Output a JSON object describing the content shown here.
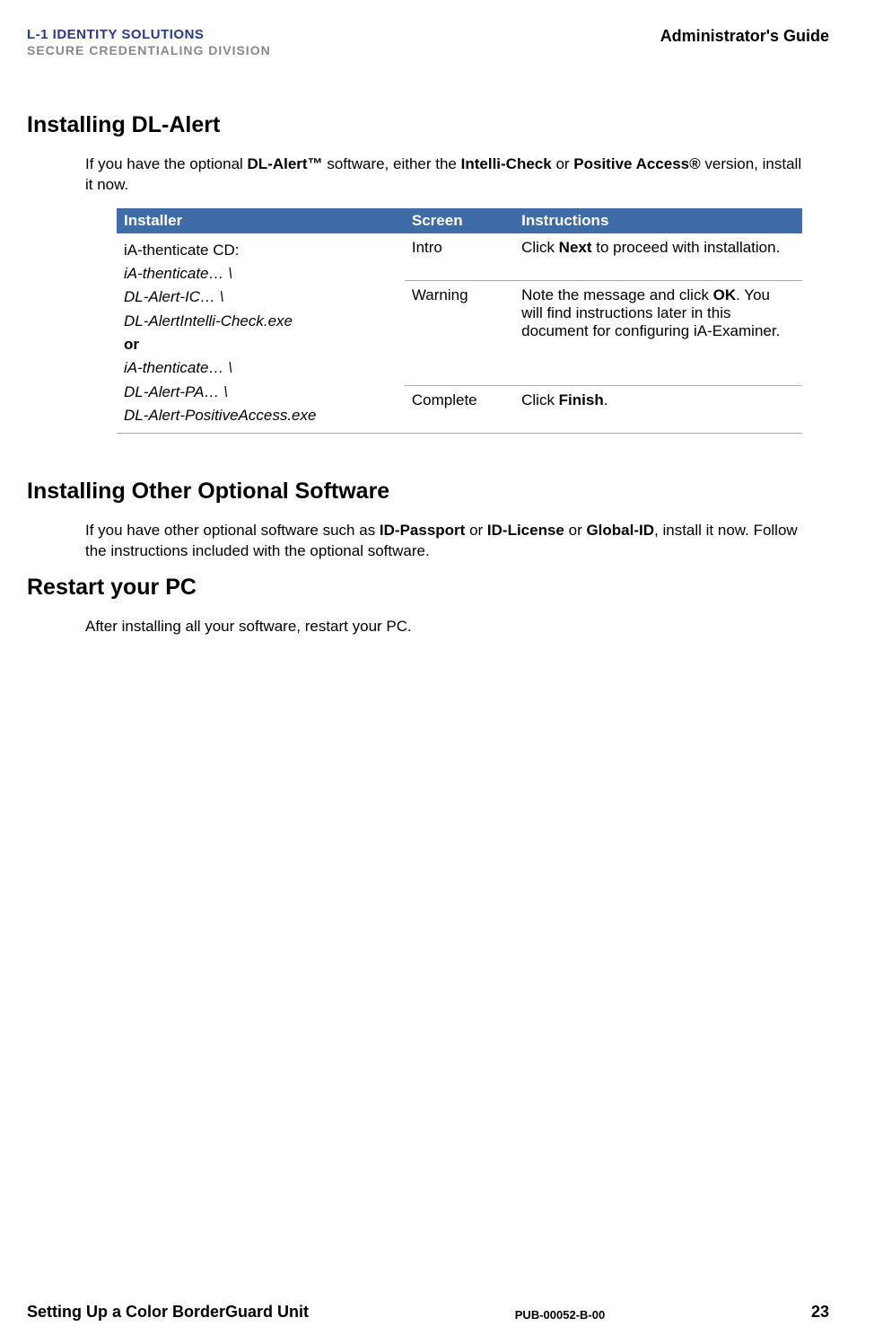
{
  "header": {
    "logo_line1": "L-1 IDENTITY SOLUTIONS",
    "logo_line2": "SECURE CREDENTIALING DIVISION",
    "doc_title": "Administrator's Guide"
  },
  "sections": {
    "dl_alert": {
      "heading": "Installing DL-Alert",
      "intro_pre": "If you have the optional ",
      "intro_b1": "DL-Alert™",
      "intro_mid1": " software, either the ",
      "intro_b2": "Intelli-Check",
      "intro_mid2": " or ",
      "intro_b3": "Positive Access®",
      "intro_post": " version, install it now."
    },
    "table": {
      "h1": "Installer",
      "h2": "Screen",
      "h3": "Instructions",
      "installer": {
        "line1": "iA-thenticate CD:",
        "line2": "iA-thenticate… \\",
        "line3": "DL-Alert-IC… \\",
        "line4": "DL-AlertIntelli-Check.exe",
        "line5": "or",
        "line6": "iA-thenticate… \\",
        "line7": "DL-Alert-PA… \\",
        "line8": "DL-Alert-PositiveAccess.exe"
      },
      "rows": [
        {
          "screen": "Intro",
          "instr_pre": "Click ",
          "instr_b1": "Next",
          "instr_post": " to proceed with installation."
        },
        {
          "screen": "Warning",
          "instr_pre": "Note the message and click ",
          "instr_b1": "OK",
          "instr_post": ". You will find instructions later in this document for configuring iA-Examiner."
        },
        {
          "screen": "Complete",
          "instr_pre": "Click ",
          "instr_b1": "Finish",
          "instr_post": "."
        }
      ]
    },
    "other_software": {
      "heading": "Installing Other Optional Software",
      "intro_pre": "If you have other optional software such as ",
      "intro_b1": "ID-Passport",
      "intro_mid1": " or ",
      "intro_b2": "ID-License",
      "intro_mid2": " or ",
      "intro_b3": "Global-ID",
      "intro_post": ", install it now. Follow the instructions included with the optional software."
    },
    "restart": {
      "heading": "Restart your PC",
      "body": "After installing all your software, restart your PC."
    }
  },
  "footer": {
    "left": "Setting Up a Color BorderGuard Unit",
    "center": "PUB-00052-B-00",
    "right": "23"
  }
}
